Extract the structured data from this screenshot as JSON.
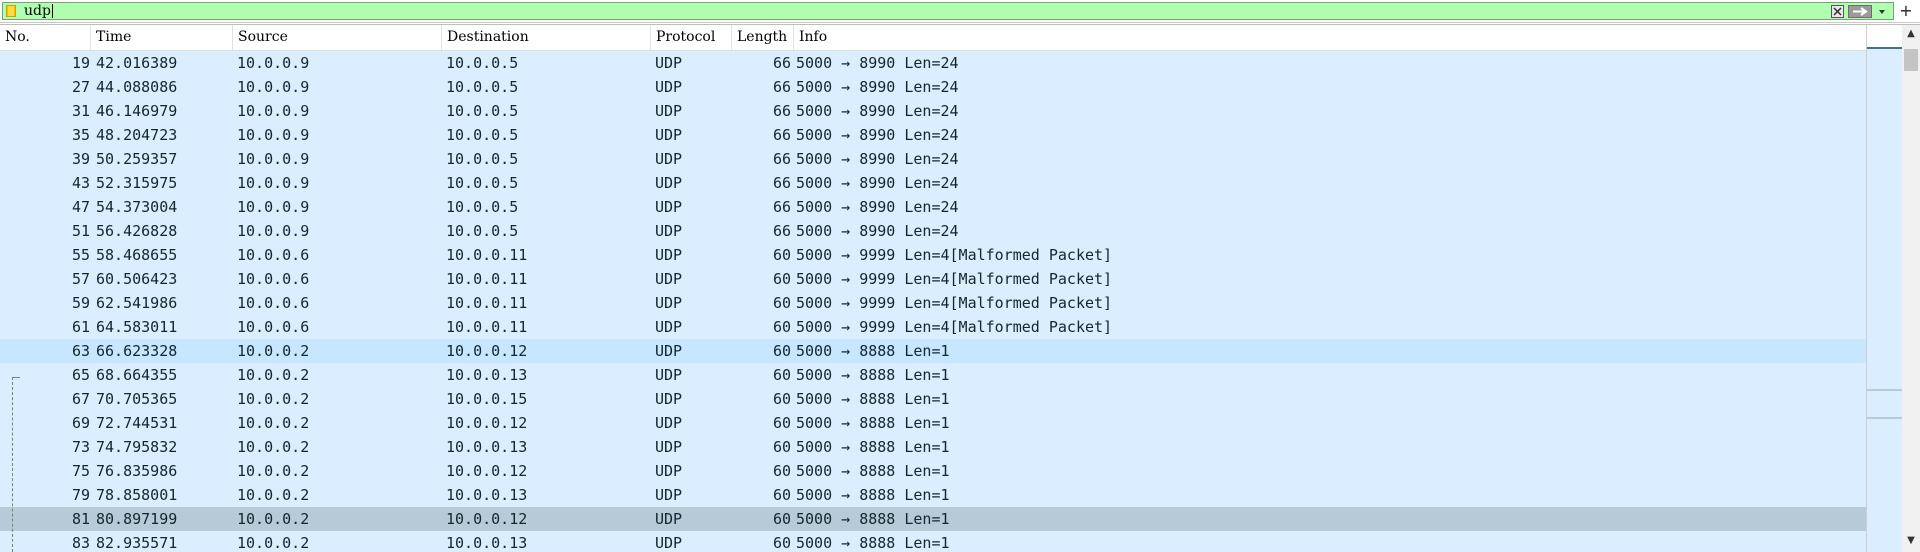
{
  "filter": {
    "value": "udp",
    "add_symbol": "+"
  },
  "colors": {
    "filter_valid_bg": "#afffaf",
    "udp_row_bg": "#daeeff",
    "selected_row_bg": "#c7e6ff",
    "marked_row_bg": "#b6cad8",
    "row_text": "#12272e"
  },
  "columns": [
    "No.",
    "Time",
    "Source",
    "Destination",
    "Protocol",
    "Length",
    "Info"
  ],
  "packets": [
    {
      "no": "19",
      "time": "42.016389",
      "src": "10.0.0.9",
      "dst": "10.0.0.5",
      "proto": "UDP",
      "len": "66",
      "info": "5000 → 8990 Len=24",
      "state": "normal"
    },
    {
      "no": "27",
      "time": "44.088086",
      "src": "10.0.0.9",
      "dst": "10.0.0.5",
      "proto": "UDP",
      "len": "66",
      "info": "5000 → 8990 Len=24",
      "state": "normal"
    },
    {
      "no": "31",
      "time": "46.146979",
      "src": "10.0.0.9",
      "dst": "10.0.0.5",
      "proto": "UDP",
      "len": "66",
      "info": "5000 → 8990 Len=24",
      "state": "normal"
    },
    {
      "no": "35",
      "time": "48.204723",
      "src": "10.0.0.9",
      "dst": "10.0.0.5",
      "proto": "UDP",
      "len": "66",
      "info": "5000 → 8990 Len=24",
      "state": "normal"
    },
    {
      "no": "39",
      "time": "50.259357",
      "src": "10.0.0.9",
      "dst": "10.0.0.5",
      "proto": "UDP",
      "len": "66",
      "info": "5000 → 8990 Len=24",
      "state": "normal"
    },
    {
      "no": "43",
      "time": "52.315975",
      "src": "10.0.0.9",
      "dst": "10.0.0.5",
      "proto": "UDP",
      "len": "66",
      "info": "5000 → 8990 Len=24",
      "state": "normal"
    },
    {
      "no": "47",
      "time": "54.373004",
      "src": "10.0.0.9",
      "dst": "10.0.0.5",
      "proto": "UDP",
      "len": "66",
      "info": "5000 → 8990 Len=24",
      "state": "normal"
    },
    {
      "no": "51",
      "time": "56.426828",
      "src": "10.0.0.9",
      "dst": "10.0.0.5",
      "proto": "UDP",
      "len": "66",
      "info": "5000 → 8990 Len=24",
      "state": "normal"
    },
    {
      "no": "55",
      "time": "58.468655",
      "src": "10.0.0.6",
      "dst": "10.0.0.11",
      "proto": "UDP",
      "len": "60",
      "info": "5000 → 9999 Len=4[Malformed Packet]",
      "state": "normal"
    },
    {
      "no": "57",
      "time": "60.506423",
      "src": "10.0.0.6",
      "dst": "10.0.0.11",
      "proto": "UDP",
      "len": "60",
      "info": "5000 → 9999 Len=4[Malformed Packet]",
      "state": "normal"
    },
    {
      "no": "59",
      "time": "62.541986",
      "src": "10.0.0.6",
      "dst": "10.0.0.11",
      "proto": "UDP",
      "len": "60",
      "info": "5000 → 9999 Len=4[Malformed Packet]",
      "state": "normal"
    },
    {
      "no": "61",
      "time": "64.583011",
      "src": "10.0.0.6",
      "dst": "10.0.0.11",
      "proto": "UDP",
      "len": "60",
      "info": "5000 → 9999 Len=4[Malformed Packet]",
      "state": "normal"
    },
    {
      "no": "63",
      "time": "66.623328",
      "src": "10.0.0.2",
      "dst": "10.0.0.12",
      "proto": "UDP",
      "len": "60",
      "info": "5000 → 8888 Len=1",
      "state": "selected"
    },
    {
      "no": "65",
      "time": "68.664355",
      "src": "10.0.0.2",
      "dst": "10.0.0.13",
      "proto": "UDP",
      "len": "60",
      "info": "5000 → 8888 Len=1",
      "state": "normal"
    },
    {
      "no": "67",
      "time": "70.705365",
      "src": "10.0.0.2",
      "dst": "10.0.0.15",
      "proto": "UDP",
      "len": "60",
      "info": "5000 → 8888 Len=1",
      "state": "normal"
    },
    {
      "no": "69",
      "time": "72.744531",
      "src": "10.0.0.2",
      "dst": "10.0.0.12",
      "proto": "UDP",
      "len": "60",
      "info": "5000 → 8888 Len=1",
      "state": "normal"
    },
    {
      "no": "73",
      "time": "74.795832",
      "src": "10.0.0.2",
      "dst": "10.0.0.13",
      "proto": "UDP",
      "len": "60",
      "info": "5000 → 8888 Len=1",
      "state": "normal"
    },
    {
      "no": "75",
      "time": "76.835986",
      "src": "10.0.0.2",
      "dst": "10.0.0.12",
      "proto": "UDP",
      "len": "60",
      "info": "5000 → 8888 Len=1",
      "state": "normal"
    },
    {
      "no": "79",
      "time": "78.858001",
      "src": "10.0.0.2",
      "dst": "10.0.0.13",
      "proto": "UDP",
      "len": "60",
      "info": "5000 → 8888 Len=1",
      "state": "normal"
    },
    {
      "no": "81",
      "time": "80.897199",
      "src": "10.0.0.2",
      "dst": "10.0.0.12",
      "proto": "UDP",
      "len": "60",
      "info": "5000 → 8888 Len=1",
      "state": "marked"
    },
    {
      "no": "83",
      "time": "82.935571",
      "src": "10.0.0.2",
      "dst": "10.0.0.13",
      "proto": "UDP",
      "len": "60",
      "info": "5000 → 8888 Len=1",
      "state": "normal"
    }
  ]
}
